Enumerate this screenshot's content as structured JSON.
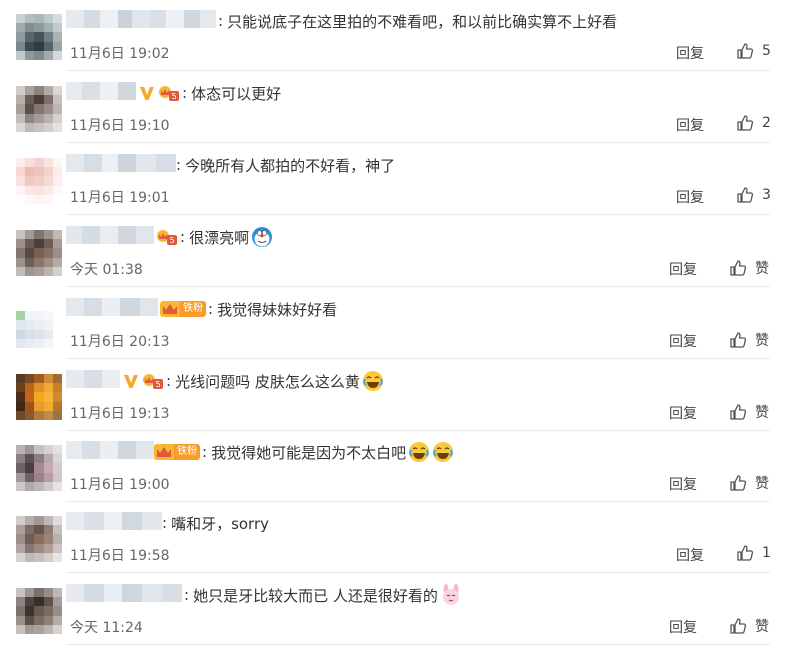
{
  "labels": {
    "reply": "回复"
  },
  "comments": [
    {
      "text": "只能说底子在这里拍的不难看吧，和以前比确实算不上好看",
      "time": "11月6日 19:02",
      "likes": "5",
      "emojis": []
    },
    {
      "text": "体态可以更好",
      "time": "11月6日 19:10",
      "likes": "2",
      "emojis": []
    },
    {
      "text": "今晚所有人都拍的不好看，神了",
      "time": "11月6日 19:01",
      "likes": "3",
      "emojis": []
    },
    {
      "text": "很漂亮啊",
      "time": "今天 01:38",
      "likes": "赞",
      "emojis": [
        "doraemon"
      ]
    },
    {
      "text": "我觉得妹妹好好看",
      "time": "11月6日 20:13",
      "likes": "赞",
      "emojis": [],
      "fan_badge": "铁粉"
    },
    {
      "text": "光线问题吗 皮肤怎么这么黄",
      "time": "11月6日 19:13",
      "likes": "赞",
      "emojis": [
        "laugh-cry"
      ]
    },
    {
      "text": "我觉得她可能是因为不太白吧",
      "time": "11月6日 19:00",
      "likes": "赞",
      "emojis": [
        "laugh-cry",
        "laugh-cry"
      ],
      "fan_badge": "铁粉"
    },
    {
      "text": "嘴和牙，sorry",
      "time": "11月6日 19:58",
      "likes": "1",
      "emojis": []
    },
    {
      "text": "她只是牙比较大而已 人还是很好看的",
      "time": "今天 11:24",
      "likes": "赞",
      "emojis": [
        "pink-bunny"
      ]
    }
  ],
  "colors": {
    "text": "#333333",
    "meta": "#666666",
    "divider": "#eaeaea",
    "vip_orange": "#f5a623",
    "badge_red": "#e2593d"
  }
}
